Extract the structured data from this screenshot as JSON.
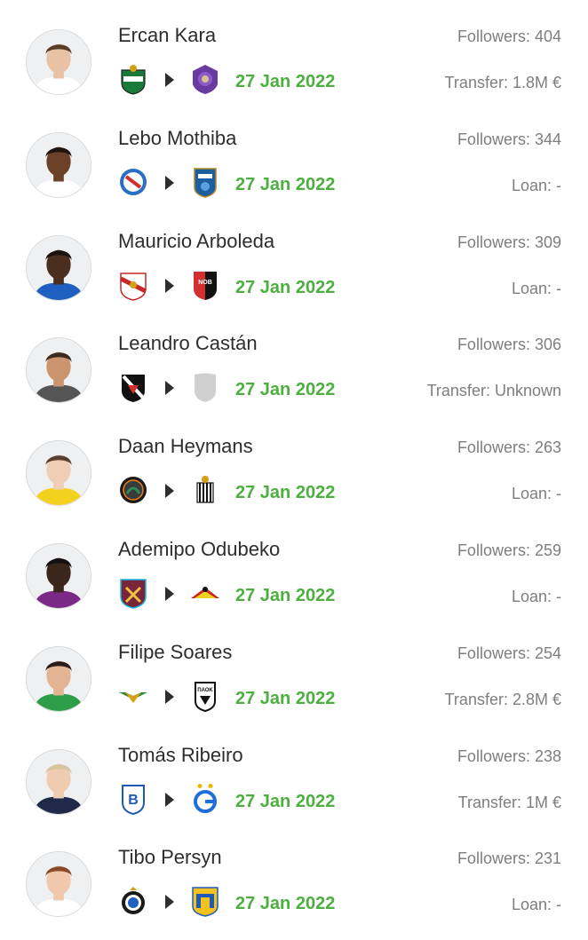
{
  "transfers": [
    {
      "name": "Ercan Kara",
      "followers": "Followers: 404",
      "date": "27 Jan 2022",
      "detail": "Transfer: 1.8M €",
      "from_crest": "rapid-wien-crest",
      "to_crest": "orlando-city-crest",
      "skin": "#e9c2a6",
      "hair": "#5a3c2a",
      "shirt": "#ffffff"
    },
    {
      "name": "Lebo Mothiba",
      "followers": "Followers: 344",
      "date": "27 Jan 2022",
      "detail": "Loan: -",
      "from_crest": "strasbourg-crest",
      "to_crest": "troyes-crest",
      "skin": "#6b4129",
      "hair": "#1e1410",
      "shirt": "#ffffff"
    },
    {
      "name": "Mauricio Arboleda",
      "followers": "Followers: 309",
      "date": "27 Jan 2022",
      "detail": "Loan: -",
      "from_crest": "rayo-vallecano-crest",
      "to_crest": "newells-old-boys-crest",
      "skin": "#4a2e1f",
      "hair": "#1a1210",
      "shirt": "#1f5fbf"
    },
    {
      "name": "Leandro Castán",
      "followers": "Followers: 306",
      "date": "27 Jan 2022",
      "detail": "Transfer: Unknown",
      "from_crest": "vasco-da-gama-crest",
      "to_crest": "unknown-club-crest",
      "skin": "#c9946e",
      "hair": "#3a2a20",
      "shirt": "#555555"
    },
    {
      "name": "Daan Heymans",
      "followers": "Followers: 263",
      "date": "27 Jan 2022",
      "detail": "Loan: -",
      "from_crest": "venezia-crest",
      "to_crest": "charleroi-crest",
      "skin": "#f0cdb4",
      "hair": "#5a4030",
      "shirt": "#f3d21f"
    },
    {
      "name": "Ademipo Odubeko",
      "followers": "Followers: 259",
      "date": "27 Jan 2022",
      "detail": "Loan: -",
      "from_crest": "west-ham-crest",
      "to_crest": "doncaster-rovers-crest",
      "skin": "#3b261b",
      "hair": "#141010",
      "shirt": "#7a2a86"
    },
    {
      "name": "Filipe Soares",
      "followers": "Followers: 254",
      "date": "27 Jan 2022",
      "detail": "Transfer: 2.8M €",
      "from_crest": "moreirense-crest",
      "to_crest": "paok-crest",
      "skin": "#e2b493",
      "hair": "#2a1c16",
      "shirt": "#2e9d4a"
    },
    {
      "name": "Tomás Ribeiro",
      "followers": "Followers: 238",
      "date": "27 Jan 2022",
      "detail": "Transfer: 1M €",
      "from_crest": "belenenses-crest",
      "to_crest": "grasshoppers-crest",
      "skin": "#efcbb0",
      "hair": "#d8c6a0",
      "shirt": "#1f2a4a"
    },
    {
      "name": "Tibo Persyn",
      "followers": "Followers: 231",
      "date": "27 Jan 2022",
      "detail": "Loan: -",
      "from_crest": "club-brugge-crest",
      "to_crest": "westerlo-crest",
      "skin": "#f2c8ad",
      "hair": "#8a4a2a",
      "shirt": "#ffffff"
    }
  ]
}
